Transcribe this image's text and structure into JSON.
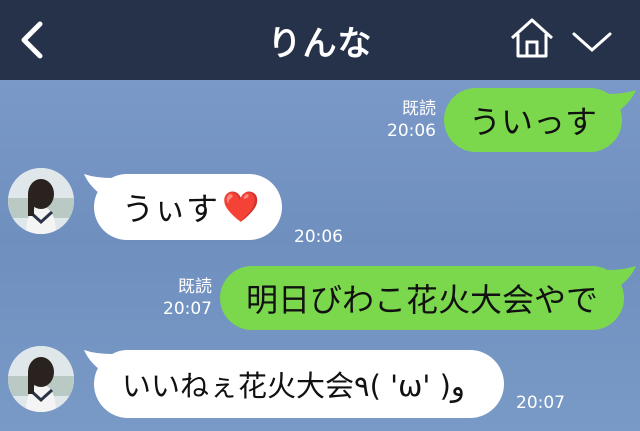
{
  "header": {
    "title": "りんな",
    "back_icon": "chevron-left-icon",
    "home_icon": "home-icon",
    "menu_icon": "chevron-down-icon"
  },
  "messages": [
    {
      "direction": "out",
      "text": "ういっす",
      "read": "既読",
      "time": "20:06"
    },
    {
      "direction": "in",
      "text": "うぃす",
      "emoji": "❤️",
      "time": "20:06"
    },
    {
      "direction": "out",
      "text": "明日びわこ花火大会やで",
      "read": "既読",
      "time": "20:07"
    },
    {
      "direction": "in",
      "text": "いいねぇ花火大会٩( 'ω' )و",
      "time": "20:07"
    }
  ],
  "colors": {
    "header_bg": "#25324a",
    "chat_bg": "#7895c4",
    "outgoing_bubble": "#7bd84c",
    "incoming_bubble": "#ffffff"
  }
}
